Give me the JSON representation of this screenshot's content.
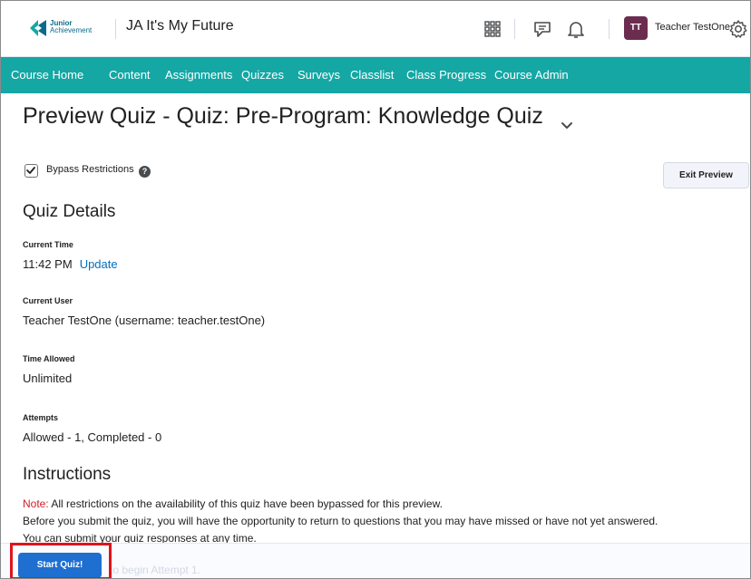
{
  "header": {
    "logo": {
      "line1": "Junior",
      "line2": "Achievement"
    },
    "org_title": "JA It's My Future",
    "icons": [
      "apps-grid-icon",
      "message-icon",
      "bell-icon",
      "gear-icon"
    ],
    "user": {
      "initials": "TT",
      "name": "Teacher TestOne",
      "avatar_color": "#6b2d4f"
    }
  },
  "nav": {
    "color": "#14a7a4",
    "items": [
      "Course Home",
      "Content",
      "Assignments",
      "Quizzes",
      "Surveys",
      "Classlist",
      "Class Progress",
      "Course Admin"
    ]
  },
  "page": {
    "title": "Preview Quiz - Quiz: Pre-Program: Knowledge Quiz",
    "bypass": {
      "label": "Bypass Restrictions",
      "checked": true,
      "help": "?"
    },
    "exit_label": "Exit Preview"
  },
  "details": {
    "heading": "Quiz Details",
    "current_time": {
      "label": "Current Time",
      "value": "11:42 PM",
      "link": "Update"
    },
    "current_user": {
      "label": "Current User",
      "value": "Teacher TestOne (username: teacher.testOne)"
    },
    "time_allowed": {
      "label": "Time Allowed",
      "value": "Unlimited"
    },
    "attempts": {
      "label": "Attempts",
      "value": "Allowed - 1, Completed - 0"
    }
  },
  "instructions": {
    "heading": "Instructions",
    "note_label": "Note:",
    "note_text": " All restrictions on the availability of this quiz have been bypassed for this preview.",
    "line2": "Before you submit the quiz, you will have the opportunity to return to questions that you may have missed or have not yet answered.",
    "line3": "You can submit your quiz responses at any time."
  },
  "footer": {
    "start_label": "Start Quiz!",
    "hint": "to begin Attempt 1.",
    "highlight_color": "#e0141b"
  }
}
